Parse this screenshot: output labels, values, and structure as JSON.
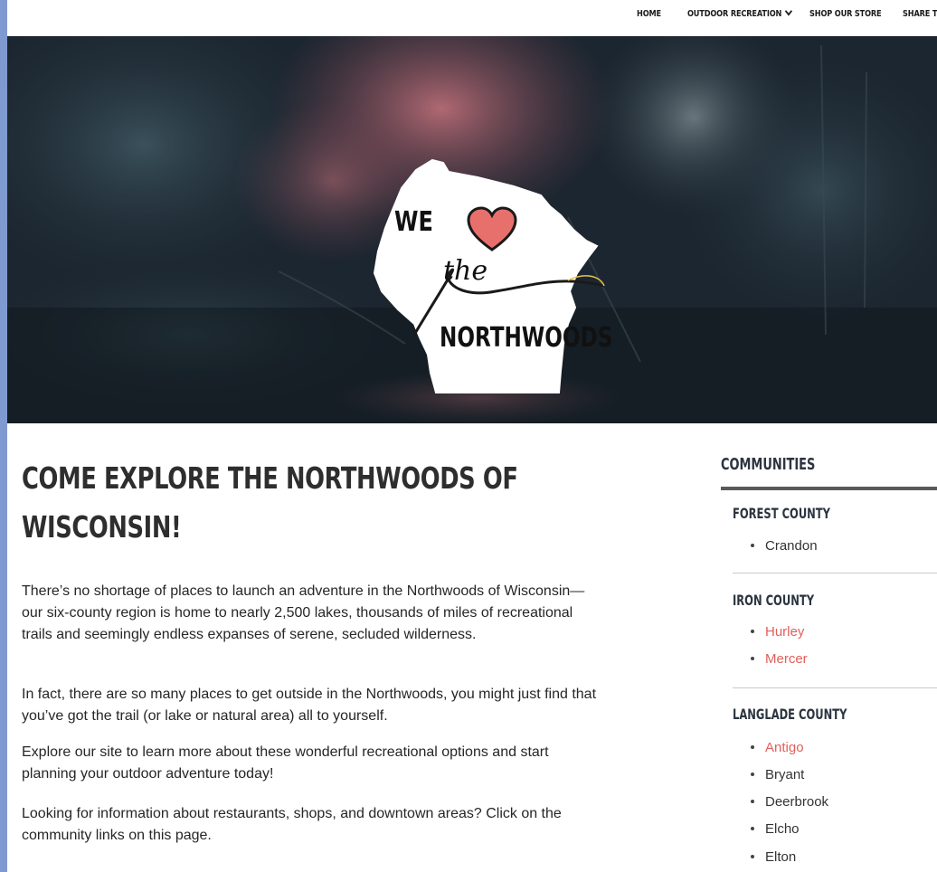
{
  "nav": {
    "items": [
      "HOME",
      "OUTDOOR RECREATION",
      "SHOP OUR STORE",
      "SHARE T"
    ]
  },
  "hero": {
    "logo": {
      "line1": "WE",
      "line2": "the",
      "line3": "NORTHWOODS",
      "heart_color": "#e8706c"
    }
  },
  "main": {
    "heading_line1": "COME EXPLORE THE NORTHWOODS OF",
    "heading_line2": "WISCONSIN!",
    "paragraphs": [
      "There’s no shortage of places to launch an adventure in the Northwoods of Wisconsin—our six-county region is home to nearly 2,500 lakes, thousands of miles of recreational trails and seemingly endless expanses of serene, secluded wilderness.",
      "In fact, there are so many places to get outside in the Northwoods, you might just find that you’ve got the trail (or lake or natural area) all to yourself.",
      "Explore our site to learn more about these wonderful recreational options and start planning your outdoor adventure today!",
      "Looking for information about restaurants, shops, and downtown areas? Click on the community links on this page."
    ]
  },
  "sidebar": {
    "title": "COMMUNITIES",
    "counties": [
      {
        "name": "FOREST COUNTY",
        "towns": [
          "Crandon"
        ]
      },
      {
        "name": "IRON COUNTY",
        "towns": [
          "Hurley",
          "Mercer"
        ]
      },
      {
        "name": "LANGLADE COUNTY",
        "towns": [
          "Antigo",
          "Bryant",
          "Deerbrook",
          "Elcho",
          "Elton"
        ]
      }
    ]
  },
  "colors": {
    "link": "#e0605a",
    "text": "#262626",
    "heading": "#2e2e2e",
    "frame": "#7f9ad0"
  }
}
